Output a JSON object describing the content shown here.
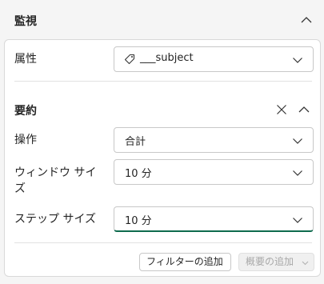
{
  "section": {
    "title": "監視"
  },
  "attribute": {
    "label": "属性",
    "value": "___subject"
  },
  "summary": {
    "title": "要約",
    "operation": {
      "label": "操作",
      "value": "合計"
    },
    "window_size": {
      "label_line1": "ウィンドウ サイ",
      "label_line2": "ズ",
      "value": "10 分"
    },
    "step_size": {
      "label": "ステップ サイズ",
      "value": "10 分"
    }
  },
  "buttons": {
    "add_filter": "フィルターの追加",
    "add_summary": "概要の追加"
  },
  "colors": {
    "focus_underline": "#0f6b4e",
    "text": "#242424",
    "disabled_text": "#a8a8a8"
  },
  "icons": [
    "chevron-up-icon",
    "tag-icon",
    "chevron-down-icon",
    "close-icon"
  ]
}
